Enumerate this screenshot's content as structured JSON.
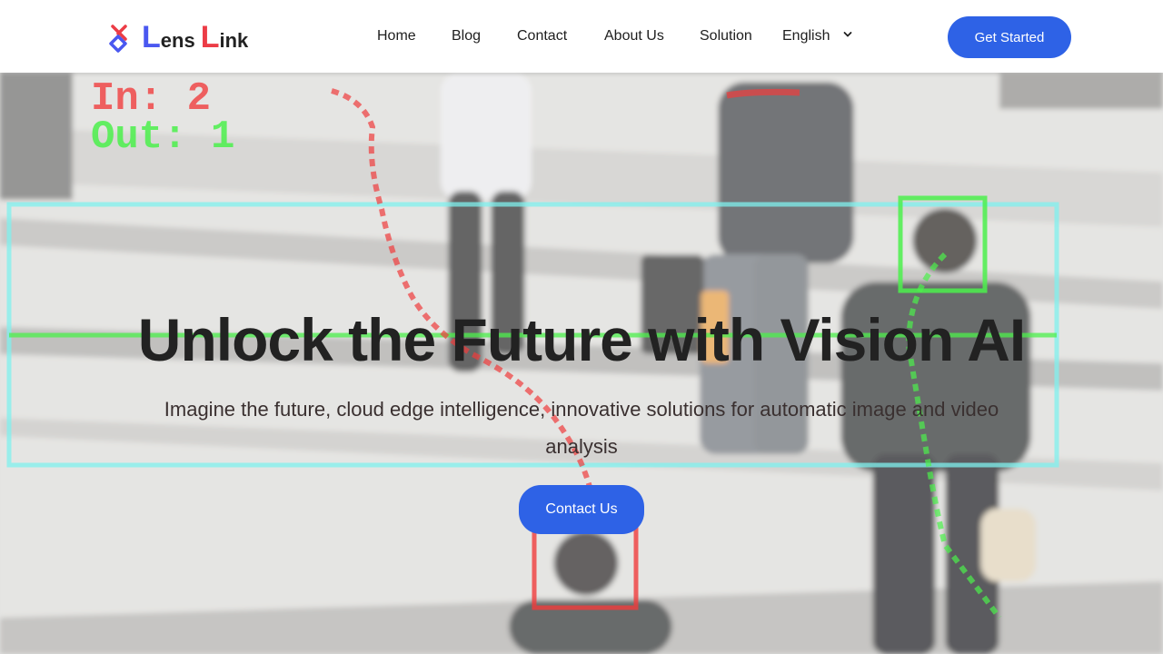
{
  "brand": {
    "name_first_letter": "L",
    "name_first_rest": "ens",
    "name_second_letter": "L",
    "name_second_rest": "ink",
    "colors": {
      "blue": "#4a58f0",
      "red": "#ec3c46"
    }
  },
  "nav": {
    "items": [
      {
        "label": "Home"
      },
      {
        "label": "Blog"
      },
      {
        "label": "Contact"
      },
      {
        "label": "About Us"
      },
      {
        "label": "Solution"
      }
    ],
    "language": {
      "selected": "English",
      "icon": "chevron-down-icon"
    },
    "cta_label": "Get Started"
  },
  "hero": {
    "title": "Unlock the Future with Vision AI",
    "subtitle": "Imagine the future, cloud edge intelligence, innovative solutions for automatic image and video analysis",
    "cta_label": "Contact Us",
    "overlay_counter": {
      "in_label": "In: 2",
      "out_label": "Out: 1"
    }
  },
  "colors": {
    "accent": "#2e62e6",
    "detect_green": "#4cf04c",
    "detect_red": "#f03c3c",
    "zone_cyan": "#7ff0ee"
  }
}
